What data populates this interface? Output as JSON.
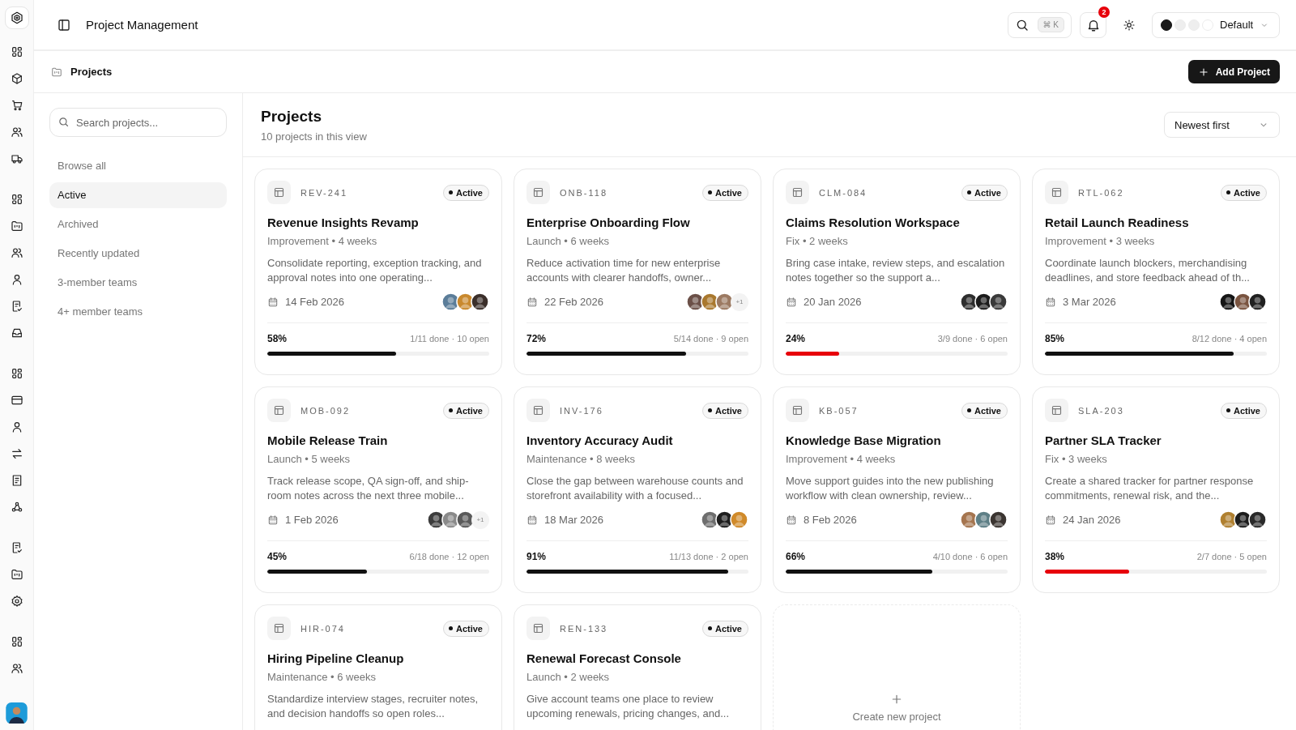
{
  "header": {
    "title": "Project Management",
    "shortcut": [
      "⌘",
      "K"
    ],
    "notifications": "2",
    "theme": {
      "label": "Default",
      "swatches": [
        {
          "color": "#1a1a1a",
          "selected": true
        },
        {
          "color": "#eeeeee",
          "selected": false
        },
        {
          "color": "#eeeeee",
          "selected": false
        },
        {
          "color": "#ffffff",
          "selected": false
        }
      ]
    }
  },
  "breadcrumb": "Projects",
  "add_button": "Add Project",
  "sidebar": {
    "search_placeholder": "Search projects...",
    "items": [
      {
        "label": "Browse all",
        "selected": false
      },
      {
        "label": "Active",
        "selected": true
      },
      {
        "label": "Archived",
        "selected": false
      },
      {
        "label": "Recently updated",
        "selected": false
      },
      {
        "label": "3-member teams",
        "selected": false
      },
      {
        "label": "4+ member teams",
        "selected": false
      }
    ]
  },
  "main": {
    "title": "Projects",
    "subtitle": "10 projects in this view",
    "sort": "Newest first"
  },
  "projects": [
    {
      "code": "REV-241",
      "status": "Active",
      "title": "Revenue Insights Revamp",
      "meta": "Improvement • 4 weeks",
      "description": "Consolidate reporting, exception tracking, and approval notes into one operating...",
      "date": "14 Feb 2026",
      "avatars": [
        {
          "color": "#5b7d99"
        },
        {
          "color": "#c9892e"
        },
        {
          "color": "#3b2f2a"
        }
      ],
      "percent": "58%",
      "level": 0.58,
      "tasks": "1/11 done · 10 open",
      "color": "#111111"
    },
    {
      "code": "ONB-118",
      "status": "Active",
      "title": "Enterprise Onboarding Flow",
      "meta": "Launch • 6 weeks",
      "description": "Reduce activation time for new enterprise accounts with clearer handoffs, owner...",
      "date": "22 Feb 2026",
      "avatars": [
        {
          "color": "#6b5048"
        },
        {
          "color": "#a9782e"
        },
        {
          "color": "#9c7a62"
        }
      ],
      "extra": "+1",
      "percent": "72%",
      "level": 0.72,
      "tasks": "5/14 done · 9 open",
      "color": "#111111"
    },
    {
      "code": "CLM-084",
      "status": "Active",
      "title": "Claims Resolution Workspace",
      "meta": "Fix • 2 weeks",
      "description": "Bring case intake, review steps, and escalation notes together so the support a...",
      "date": "20 Jan 2026",
      "avatars": [
        {
          "color": "#2e2e2e"
        },
        {
          "color": "#1c1c1c"
        },
        {
          "color": "#3a3a3a"
        }
      ],
      "percent": "24%",
      "level": 0.24,
      "tasks": "3/9 done · 6 open",
      "color": "#e7000b"
    },
    {
      "code": "RTL-062",
      "status": "Active",
      "title": "Retail Launch Readiness",
      "meta": "Improvement • 3 weeks",
      "description": "Coordinate launch blockers, merchandising deadlines, and store feedback ahead of th...",
      "date": "3 Mar 2026",
      "avatars": [
        {
          "color": "#151515"
        },
        {
          "color": "#7a5440"
        },
        {
          "color": "#202020"
        }
      ],
      "percent": "85%",
      "level": 0.85,
      "tasks": "8/12 done · 4 open",
      "color": "#111111"
    },
    {
      "code": "MOB-092",
      "status": "Active",
      "title": "Mobile Release Train",
      "meta": "Launch • 5 weeks",
      "description": "Track release scope, QA sign-off, and ship-room notes across the next three mobile...",
      "date": "1 Feb 2026",
      "avatars": [
        {
          "color": "#3c3c3c"
        },
        {
          "color": "#8a8a8a"
        },
        {
          "color": "#5a5a5a"
        }
      ],
      "extra": "+1",
      "percent": "45%",
      "level": 0.45,
      "tasks": "6/18 done · 12 open",
      "color": "#111111"
    },
    {
      "code": "INV-176",
      "status": "Active",
      "title": "Inventory Accuracy Audit",
      "meta": "Maintenance • 8 weeks",
      "description": "Close the gap between warehouse counts and storefront availability with a focused...",
      "date": "18 Mar 2026",
      "avatars": [
        {
          "color": "#6e6e6e"
        },
        {
          "color": "#1e1e1e"
        },
        {
          "color": "#d08a2a"
        }
      ],
      "percent": "91%",
      "level": 0.91,
      "tasks": "11/13 done · 2 open",
      "color": "#111111"
    },
    {
      "code": "KB-057",
      "status": "Active",
      "title": "Knowledge Base Migration",
      "meta": "Improvement • 4 weeks",
      "description": "Move support guides into the new publishing workflow with clean ownership, review...",
      "date": "8 Feb 2026",
      "avatars": [
        {
          "color": "#a5754f"
        },
        {
          "color": "#5e7f86"
        },
        {
          "color": "#3b3531"
        }
      ],
      "percent": "66%",
      "level": 0.66,
      "tasks": "4/10 done · 6 open",
      "color": "#111111"
    },
    {
      "code": "SLA-203",
      "status": "Active",
      "title": "Partner SLA Tracker",
      "meta": "Fix • 3 weeks",
      "description": "Create a shared tracker for partner response commitments, renewal risk, and the...",
      "date": "24 Jan 2026",
      "avatars": [
        {
          "color": "#b08030"
        },
        {
          "color": "#1d1d1d"
        },
        {
          "color": "#2a2a2a"
        }
      ],
      "percent": "38%",
      "level": 0.38,
      "tasks": "2/7 done · 5 open",
      "color": "#e7000b"
    },
    {
      "code": "HIR-074",
      "status": "Active",
      "title": "Hiring Pipeline Cleanup",
      "meta": "Maintenance • 6 weeks",
      "description": "Standardize interview stages, recruiter notes, and decision handoffs so open roles..."
    },
    {
      "code": "REN-133",
      "status": "Active",
      "title": "Renewal Forecast Console",
      "meta": "Launch • 2 weeks",
      "description": "Give account teams one place to review upcoming renewals, pricing changes, and..."
    }
  ],
  "new_project": "Create new project"
}
